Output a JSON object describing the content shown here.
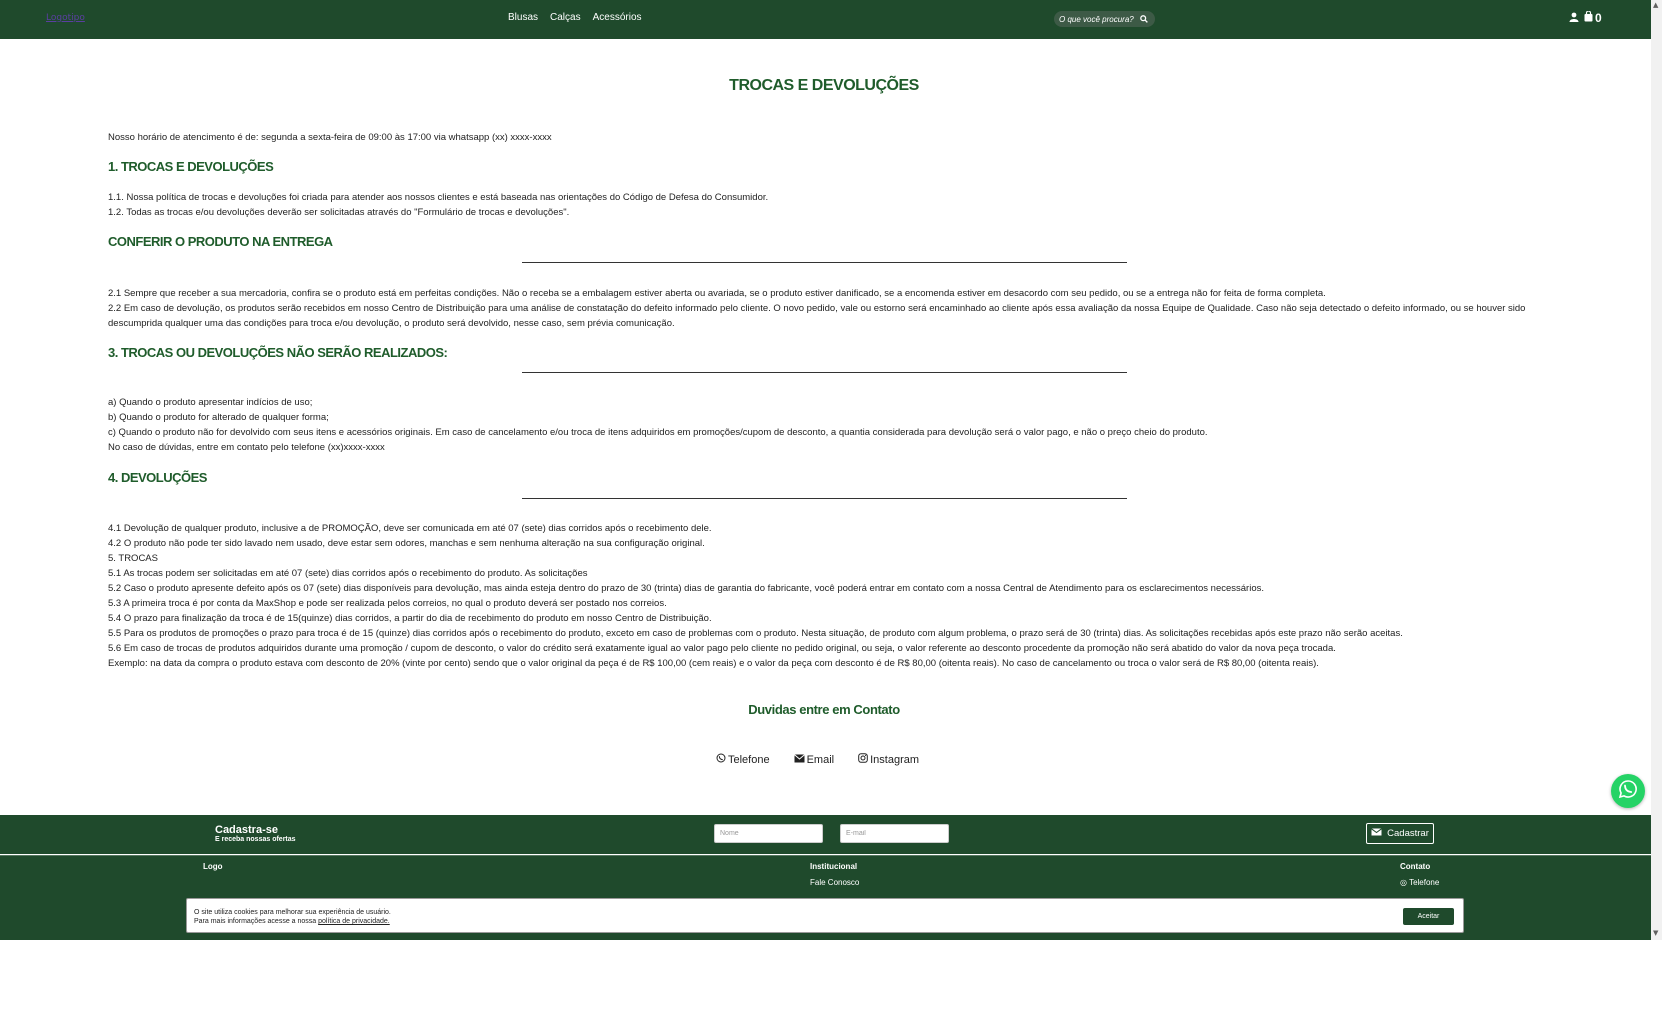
{
  "header": {
    "logo_text": "Logotipo",
    "nav": [
      "Blusas",
      "Calças",
      "Acessórios"
    ],
    "search_placeholder": "O que você procura?",
    "cart_count": "0"
  },
  "page": {
    "title": "TROCAS E DEVOLUÇÕES",
    "hours": "Nosso horário de atencimento é de: segunda a sexta-feira de 09:00 às 17:00 via whatsapp (xx) xxxx-xxxx",
    "sections": [
      {
        "heading": "1. TROCAS E DEVOLUÇÕES",
        "lines": [
          "1.1. Nossa política de trocas e devoluções foi criada para atender aos nossos clientes e está baseada nas orientações do Código de Defesa do Consumidor.",
          "1.2. Todas as trocas e/ou devoluções deverão ser solicitadas através do \"Formulário de trocas e devoluções\"."
        ]
      },
      {
        "heading": "CONFERIR O PRODUTO NA ENTREGA",
        "lines": [
          "2.1 Sempre que receber a sua mercadoria, confira se o produto está em perfeitas condições. Não o receba se a embalagem estiver aberta ou avariada, se o produto estiver danificado, se a encomenda estiver em desacordo com seu pedido, ou se a entrega não for feita de forma completa.",
          "2.2 Em caso de devolução, os produtos serão recebidos em nosso Centro de Distribuição para uma análise de constatação do defeito informado pelo cliente. O novo pedido, vale ou estorno será encaminhado ao cliente após essa avaliação da nossa Equipe de Qualidade. Caso não seja detectado o defeito informado, ou se houver sido descumprida qualquer uma das condições para troca e/ou devolução, o produto será devolvido, nesse caso, sem prévia comunicação."
        ]
      },
      {
        "heading": "3. TROCAS OU DEVOLUÇÕES NÃO SERÃO REALIZADOS:",
        "lines": [
          "a) Quando o produto apresentar indícios de uso;",
          "b) Quando o produto for alterado de qualquer forma;",
          "c) Quando o produto não for devolvido com seus itens e acessórios originais. Em caso de cancelamento e/ou troca de itens adquiridos em promoções/cupom de desconto, a quantia considerada para devolução será o valor pago, e não o preço cheio do produto.",
          "No caso de dúvidas, entre em contato pelo telefone (xx)xxxx-xxxx"
        ]
      },
      {
        "heading": "4. DEVOLUÇÕES",
        "lines": [
          "4.1 Devolução de qualquer produto, inclusive a de PROMOÇÃO, deve ser comunicada em até 07 (sete) dias corridos após o recebimento dele.",
          "4.2 O produto não pode ter sido lavado nem usado, deve estar sem odores, manchas e sem nenhuma alteração na sua configuração original.",
          "5. TROCAS",
          "5.1 As trocas podem ser solicitadas em até 07 (sete) dias corridos após o recebimento do produto. As solicitações",
          "5.2 Caso o produto apresente defeito após os 07 (sete) dias disponíveis para devolução, mas ainda esteja dentro do prazo de 30 (trinta) dias de garantia do fabricante, você poderá entrar em contato com a nossa Central de Atendimento para os esclarecimentos necessários.",
          "5.3 A primeira troca é por conta da MaxShop e pode ser realizada pelos correios, no qual o produto deverá ser postado nos correios.",
          "5.4 O prazo para finalização da troca é de 15(quinze) dias corridos, a partir do dia de recebimento do produto em nosso Centro de Distribuição.",
          "5.5 Para os produtos de promoções o prazo para troca é de 15 (quinze) dias corridos após o recebimento do produto, exceto em caso de problemas com o produto. Nesta situação, de produto com algum problema, o prazo será de 30 (trinta) dias. As solicitações recebidas após este prazo não serão aceitas.",
          "5.6 Em caso de trocas de produtos adquiridos durante uma promoção / cupom de desconto, o valor do crédito será exatamente igual ao valor pago pelo cliente no pedido original, ou seja, o valor referente ao desconto procedente da promoção não será abatido do valor da nova peça trocada.",
          "Exemplo: na data da compra o produto estava com desconto de 20% (vinte por cento) sendo que o valor original da peça é de R$ 100,00 (cem reais) e o valor da peça com desconto é de R$ 80,00 (oitenta reais). No caso de cancelamento ou troca o valor será de R$ 80,00 (oitenta reais)."
        ]
      }
    ],
    "contact_title": "Duvidas entre em Contato",
    "contact_links": [
      "Telefone",
      "Email",
      "Instagram"
    ]
  },
  "newsletter": {
    "title": "Cadastra-se",
    "subtitle": "E receba nossas ofertas",
    "name_placeholder": "Nome",
    "email_placeholder": "E-mail",
    "button": "Cadastrar"
  },
  "footer": {
    "col1_head": "Logo",
    "col2_head": "Institucional",
    "col2_links": [
      "Fale Conosco"
    ],
    "col3_head": "Contato",
    "col3_links": [
      "Telefone"
    ]
  },
  "cookie": {
    "line1": "O site utiliza cookies para melhorar sua experiência de usuário.",
    "line2_prefix": "Para mais informações acesse a nossa ",
    "link": "política de privacidade.",
    "button": "Aceitar"
  },
  "colors": {
    "brand_green": "#1f4a2c",
    "heading_green": "#1f5c2b",
    "whatsapp": "#25d366"
  }
}
